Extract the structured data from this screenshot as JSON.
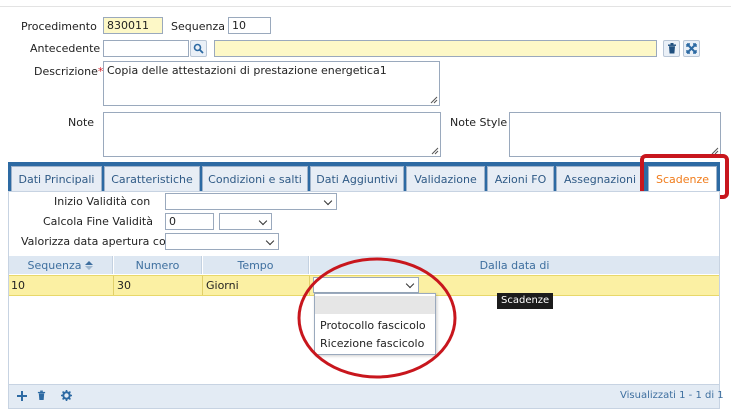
{
  "form": {
    "procedimento_label": "Procedimento",
    "procedimento_value": "830011",
    "sequenza_label": "Sequenza",
    "sequenza_value": "10",
    "antecedente_label": "Antecedente",
    "antecedente_value": "",
    "antecedente_desc": "",
    "descrizione_label": "Descrizione",
    "descrizione_required": "*",
    "descrizione_value": "Copia delle attestazioni di prestazione energetica1",
    "note_label": "Note",
    "note_value": "",
    "note_style_label": "Note Style",
    "note_style_value": ""
  },
  "tabs": [
    {
      "label": "Dati Principali"
    },
    {
      "label": "Caratteristiche"
    },
    {
      "label": "Condizioni e salti"
    },
    {
      "label": "Dati Aggiuntivi"
    },
    {
      "label": "Validazione"
    },
    {
      "label": "Azioni FO"
    },
    {
      "label": "Assegnazioni"
    },
    {
      "label": "Scadenze",
      "active": true
    }
  ],
  "scadenze": {
    "inizio_validita_label": "Inizio Validità con",
    "inizio_validita_value": "",
    "calcola_fine_label": "Calcola Fine Validità",
    "calcola_fine_value": "0",
    "calcola_fine_unit": "",
    "valorizza_label": "Valorizza data apertura con",
    "valorizza_value": ""
  },
  "grid": {
    "columns": [
      "Sequenza",
      "Numero",
      "Tempo",
      "Dalla data di"
    ],
    "sort_column": "Sequenza",
    "rows": [
      {
        "sequenza": "10",
        "numero": "30",
        "tempo": "Giorni",
        "dalla_data_di": ""
      }
    ],
    "footer_status": "Visualizzati 1 - 1 di 1"
  },
  "dropdown": {
    "options": [
      "",
      "Protocollo fascicolo",
      "Ricezione fascicolo"
    ]
  },
  "tooltip": {
    "text": "Scadenze"
  },
  "icons": [
    "search-icon",
    "trash-icon",
    "clear-icon",
    "chevron-down-icon",
    "sort-asc-icon",
    "add-icon",
    "gear-icon"
  ],
  "colors": {
    "tab_bar": "#2d6aa3",
    "active_tab_text": "#f07c1b",
    "highlight_row": "#fbf0a3",
    "required_field": "#fdf8c7",
    "annotation_red": "#c8161d"
  }
}
